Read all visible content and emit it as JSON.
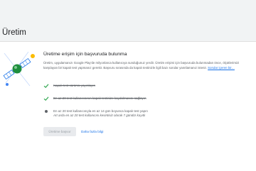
{
  "page": {
    "title": "Üretim"
  },
  "card": {
    "title": "Üretime erişim için başvuruda bulunma",
    "description": "Üretim, uygulamanızı Google Play'de milyonlarca kullanıcıya sunduğunuz yerdir. Üretim erişimi için başvuruda bulunmadan önce, ölçütlerimizi karşılayan bir kapalı test yapmanız gerekir. Başvuru sırasında da kapalı testinizle ilgili bazı sorular yanıtlamanız istenir.",
    "description_link": "Sorular içeren bir…",
    "requirements": [
      {
        "text": "Kapalı test sürümü yayınlayın",
        "status": "done"
      },
      {
        "text": "En az 20 test kullanıcısının kapalı testinize kaydolmasını sağlayın",
        "status": "done"
      },
      {
        "text": "En az 20 test kullanıcısıyla en az 14 gün boyunca kapalı test yapın",
        "subtext": "Art arda en az 20 test kullanıcısı kesintisiz olarak 7 gündür kayıtlı",
        "status": "pending"
      }
    ],
    "apply_button": "Üretime başvur",
    "more_link": "Daha fazla bilgi"
  },
  "colors": {
    "accent": "#1a73e8",
    "check": "#34a853",
    "illustration_green": "#1e8e3e"
  }
}
